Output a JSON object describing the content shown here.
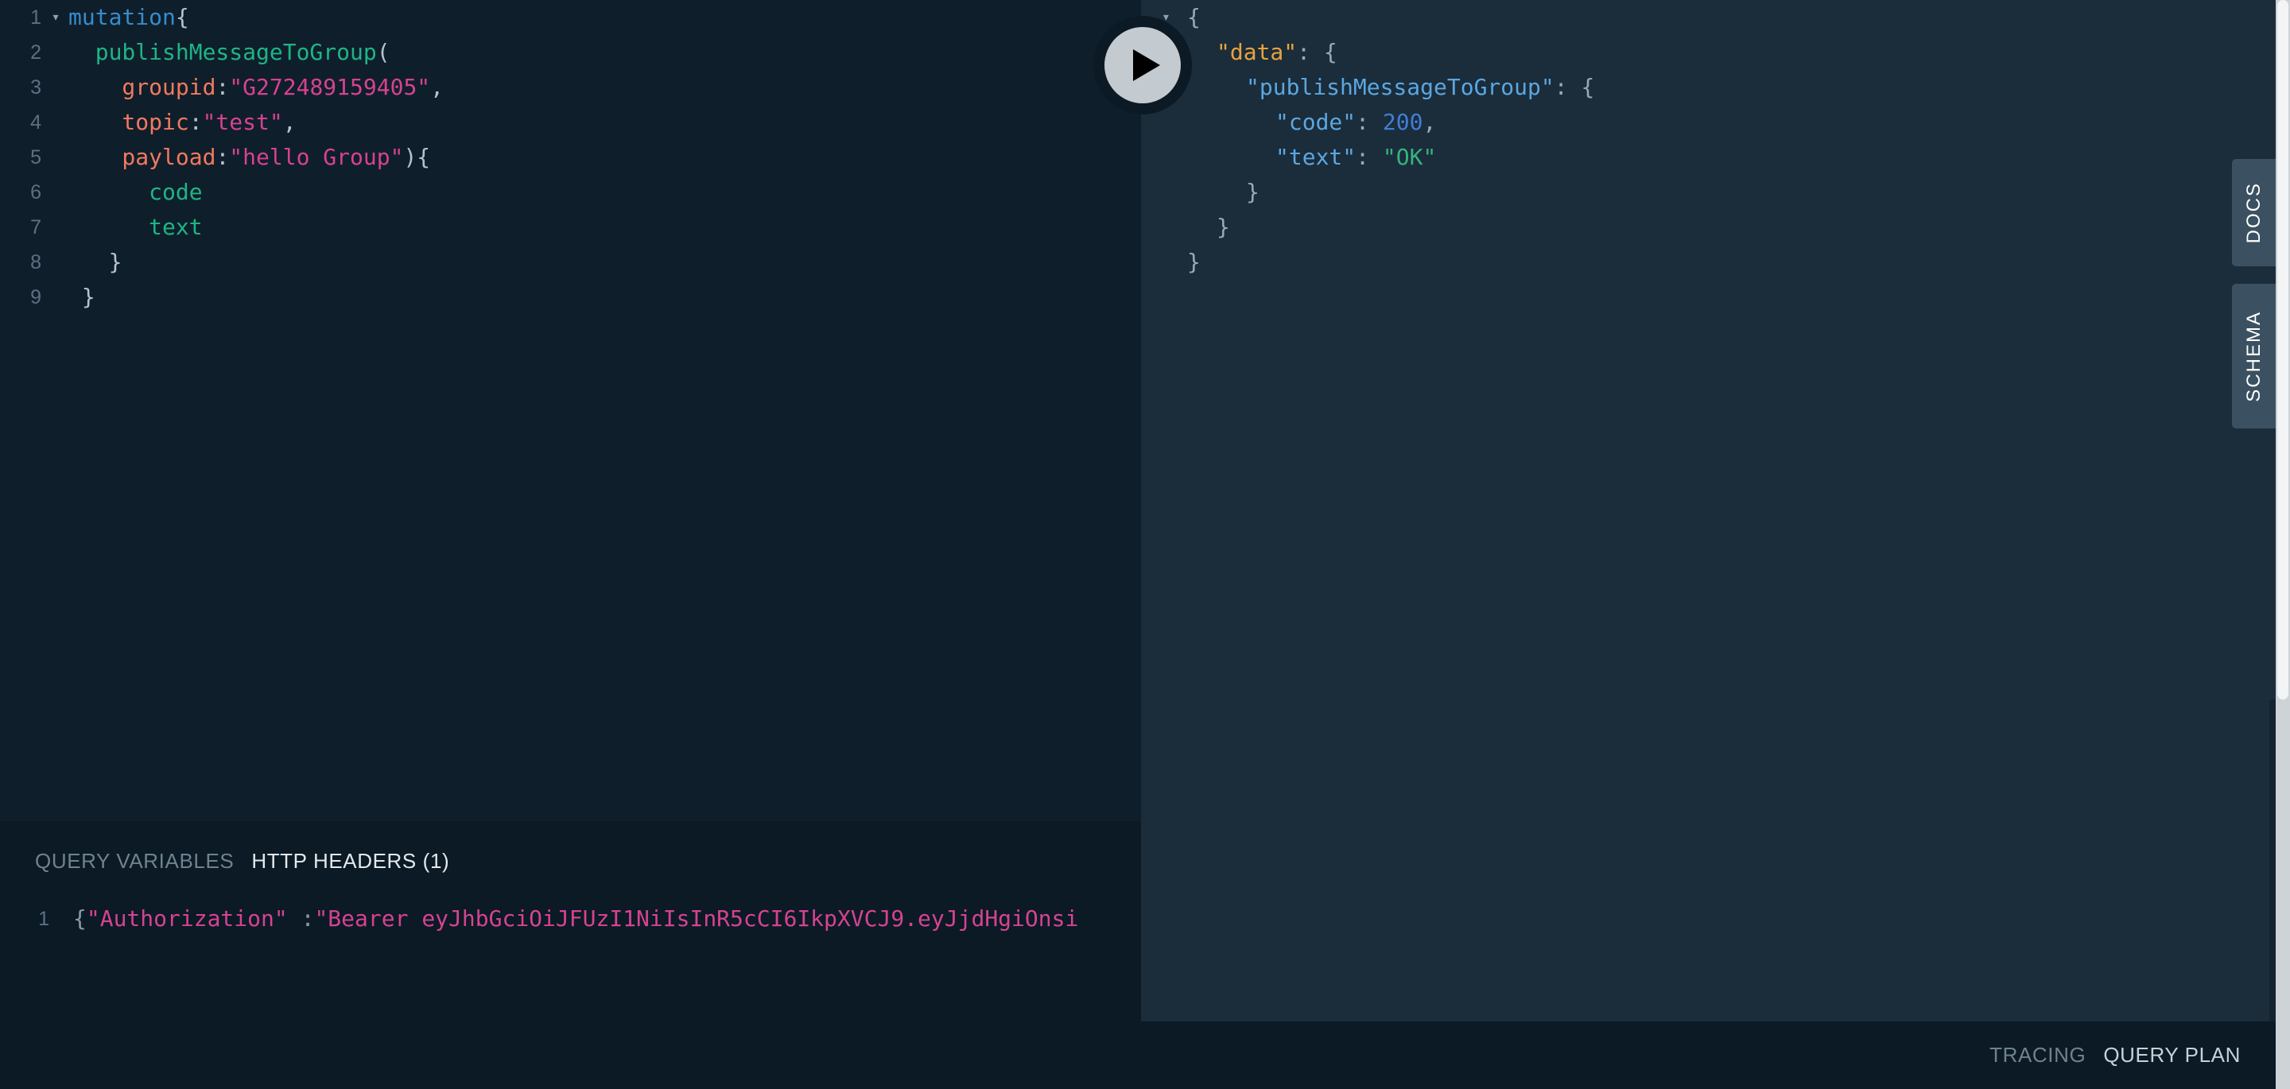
{
  "colors": {
    "editor_bg": "#0f1e2b",
    "response_bg": "#1b2c3b",
    "bottom_bg": "#0b1a25",
    "side_tab_bg": "#3b5161",
    "accent_string": "#d64292",
    "accent_field": "#1db586",
    "accent_arg": "#f2795f",
    "accent_keyword": "#368ccb",
    "json_key": "#5ba7e0",
    "json_data_key": "#e8a33d",
    "json_number": "#3f7fd8",
    "json_string": "#36b37e"
  },
  "execute": {
    "icon": "play-icon",
    "label": "Execute Query"
  },
  "query_editor": {
    "lines": [
      {
        "number": "1",
        "fold": "▾",
        "tokens": [
          {
            "text": "mutation",
            "cls": "t-keyword"
          },
          {
            "text": "{",
            "cls": "t-punc"
          }
        ]
      },
      {
        "number": "2",
        "fold": "",
        "tokens": [
          {
            "text": "  publishMessageToGroup",
            "cls": "t-field"
          },
          {
            "text": "(",
            "cls": "t-punc"
          }
        ]
      },
      {
        "number": "3",
        "fold": "",
        "tokens": [
          {
            "text": "    groupid",
            "cls": "t-arg"
          },
          {
            "text": ":",
            "cls": "t-punc"
          },
          {
            "text": "\"G272489159405\"",
            "cls": "t-string"
          },
          {
            "text": ",",
            "cls": "t-comma"
          }
        ]
      },
      {
        "number": "4",
        "fold": "",
        "tokens": [
          {
            "text": "    topic",
            "cls": "t-arg"
          },
          {
            "text": ":",
            "cls": "t-punc"
          },
          {
            "text": "\"test\"",
            "cls": "t-string"
          },
          {
            "text": ",",
            "cls": "t-comma"
          }
        ]
      },
      {
        "number": "5",
        "fold": "",
        "tokens": [
          {
            "text": "    payload",
            "cls": "t-arg"
          },
          {
            "text": ":",
            "cls": "t-punc"
          },
          {
            "text": "\"hello Group\"",
            "cls": "t-string"
          },
          {
            "text": "){",
            "cls": "t-punc"
          }
        ]
      },
      {
        "number": "6",
        "fold": "",
        "tokens": [
          {
            "text": "      code",
            "cls": "t-field"
          }
        ]
      },
      {
        "number": "7",
        "fold": "",
        "tokens": [
          {
            "text": "      text",
            "cls": "t-field"
          }
        ]
      },
      {
        "number": "8",
        "fold": "",
        "tokens": [
          {
            "text": "   }",
            "cls": "t-punc"
          }
        ]
      },
      {
        "number": "9",
        "fold": "",
        "tokens": [
          {
            "text": " }",
            "cls": "t-punc"
          }
        ]
      }
    ]
  },
  "variables_panel": {
    "tabs": [
      {
        "label": "QUERY VARIABLES",
        "active": false
      },
      {
        "label": "HTTP HEADERS (1)",
        "active": true
      }
    ],
    "headers_lines": [
      {
        "number": "1",
        "tokens": [
          {
            "text": "{",
            "cls": "h-punc"
          },
          {
            "text": "\"Authorization\"",
            "cls": "h-string"
          },
          {
            "text": " :",
            "cls": "h-punc"
          },
          {
            "text": "\"Bearer eyJhbGciOiJFUzI1NiIsInR5cCI6IkpXVCJ9.eyJjdHgiOnsi",
            "cls": "h-string"
          }
        ]
      }
    ]
  },
  "response_panel": {
    "lines": [
      {
        "fold": "▾",
        "indent": 0,
        "tokens": [
          {
            "text": "{",
            "cls": "j-brace"
          }
        ]
      },
      {
        "fold": "▾",
        "indent": 1,
        "tokens": [
          {
            "text": "\"data\"",
            "cls": "j-data"
          },
          {
            "text": ": {",
            "cls": "j-colon"
          }
        ]
      },
      {
        "fold": "",
        "indent": 2,
        "tokens": [
          {
            "text": "\"publishMessageToGroup\"",
            "cls": "j-key"
          },
          {
            "text": ": {",
            "cls": "j-colon"
          }
        ]
      },
      {
        "fold": "",
        "indent": 3,
        "tokens": [
          {
            "text": "\"code\"",
            "cls": "j-key"
          },
          {
            "text": ": ",
            "cls": "j-colon"
          },
          {
            "text": "200",
            "cls": "j-num"
          },
          {
            "text": ",",
            "cls": "j-colon"
          }
        ]
      },
      {
        "fold": "",
        "indent": 3,
        "tokens": [
          {
            "text": "\"text\"",
            "cls": "j-key"
          },
          {
            "text": ": ",
            "cls": "j-colon"
          },
          {
            "text": "\"OK\"",
            "cls": "j-str"
          }
        ]
      },
      {
        "fold": "",
        "indent": 2,
        "tokens": [
          {
            "text": "}",
            "cls": "j-brace"
          }
        ]
      },
      {
        "fold": "",
        "indent": 1,
        "tokens": [
          {
            "text": "}",
            "cls": "j-brace"
          }
        ]
      },
      {
        "fold": "",
        "indent": 0,
        "tokens": [
          {
            "text": "}",
            "cls": "j-brace"
          }
        ]
      }
    ],
    "bottom_tabs": [
      {
        "label": "TRACING",
        "active": false
      },
      {
        "label": "QUERY PLAN",
        "active": true
      }
    ]
  },
  "side_tabs": [
    {
      "label": "DOCS"
    },
    {
      "label": "SCHEMA"
    }
  ]
}
